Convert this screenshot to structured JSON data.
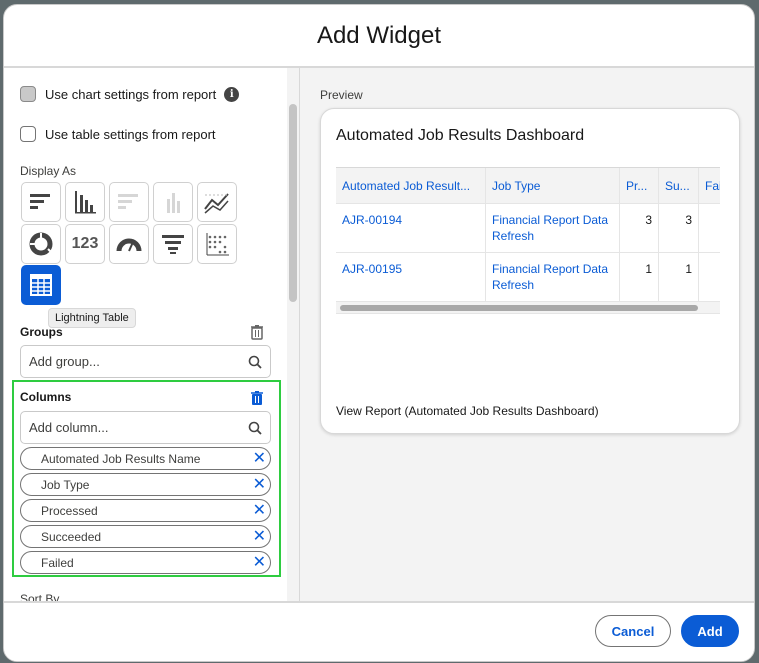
{
  "modal": {
    "title": "Add Widget"
  },
  "left": {
    "chart_settings_label": "Use chart settings from report",
    "table_settings_label": "Use table settings from report",
    "display_as_label": "Display As",
    "tooltip": "Lightning Table",
    "tile_123": "123",
    "groups": {
      "label": "Groups",
      "placeholder": "Add group..."
    },
    "columns": {
      "label": "Columns",
      "placeholder": "Add column...",
      "items": [
        "Automated Job Results Name",
        "Job Type",
        "Processed",
        "Succeeded",
        "Failed"
      ]
    },
    "sort_by_label": "Sort By"
  },
  "preview": {
    "label": "Preview",
    "card_title": "Automated Job Results Dashboard",
    "headers": [
      "Automated Job Result...",
      "Job Type",
      "Pr...",
      "Su...",
      "Fai"
    ],
    "rows": [
      [
        "AJR-00194",
        "Financial Report Data Refresh",
        "3",
        "3",
        ""
      ],
      [
        "AJR-00195",
        "Financial Report Data Refresh",
        "1",
        "1",
        ""
      ]
    ],
    "view_report": "View Report (Automated Job Results Dashboard)"
  },
  "footer": {
    "cancel": "Cancel",
    "add": "Add"
  },
  "colors": {
    "accent": "#0b5cd5",
    "highlight": "#2ecc40"
  }
}
